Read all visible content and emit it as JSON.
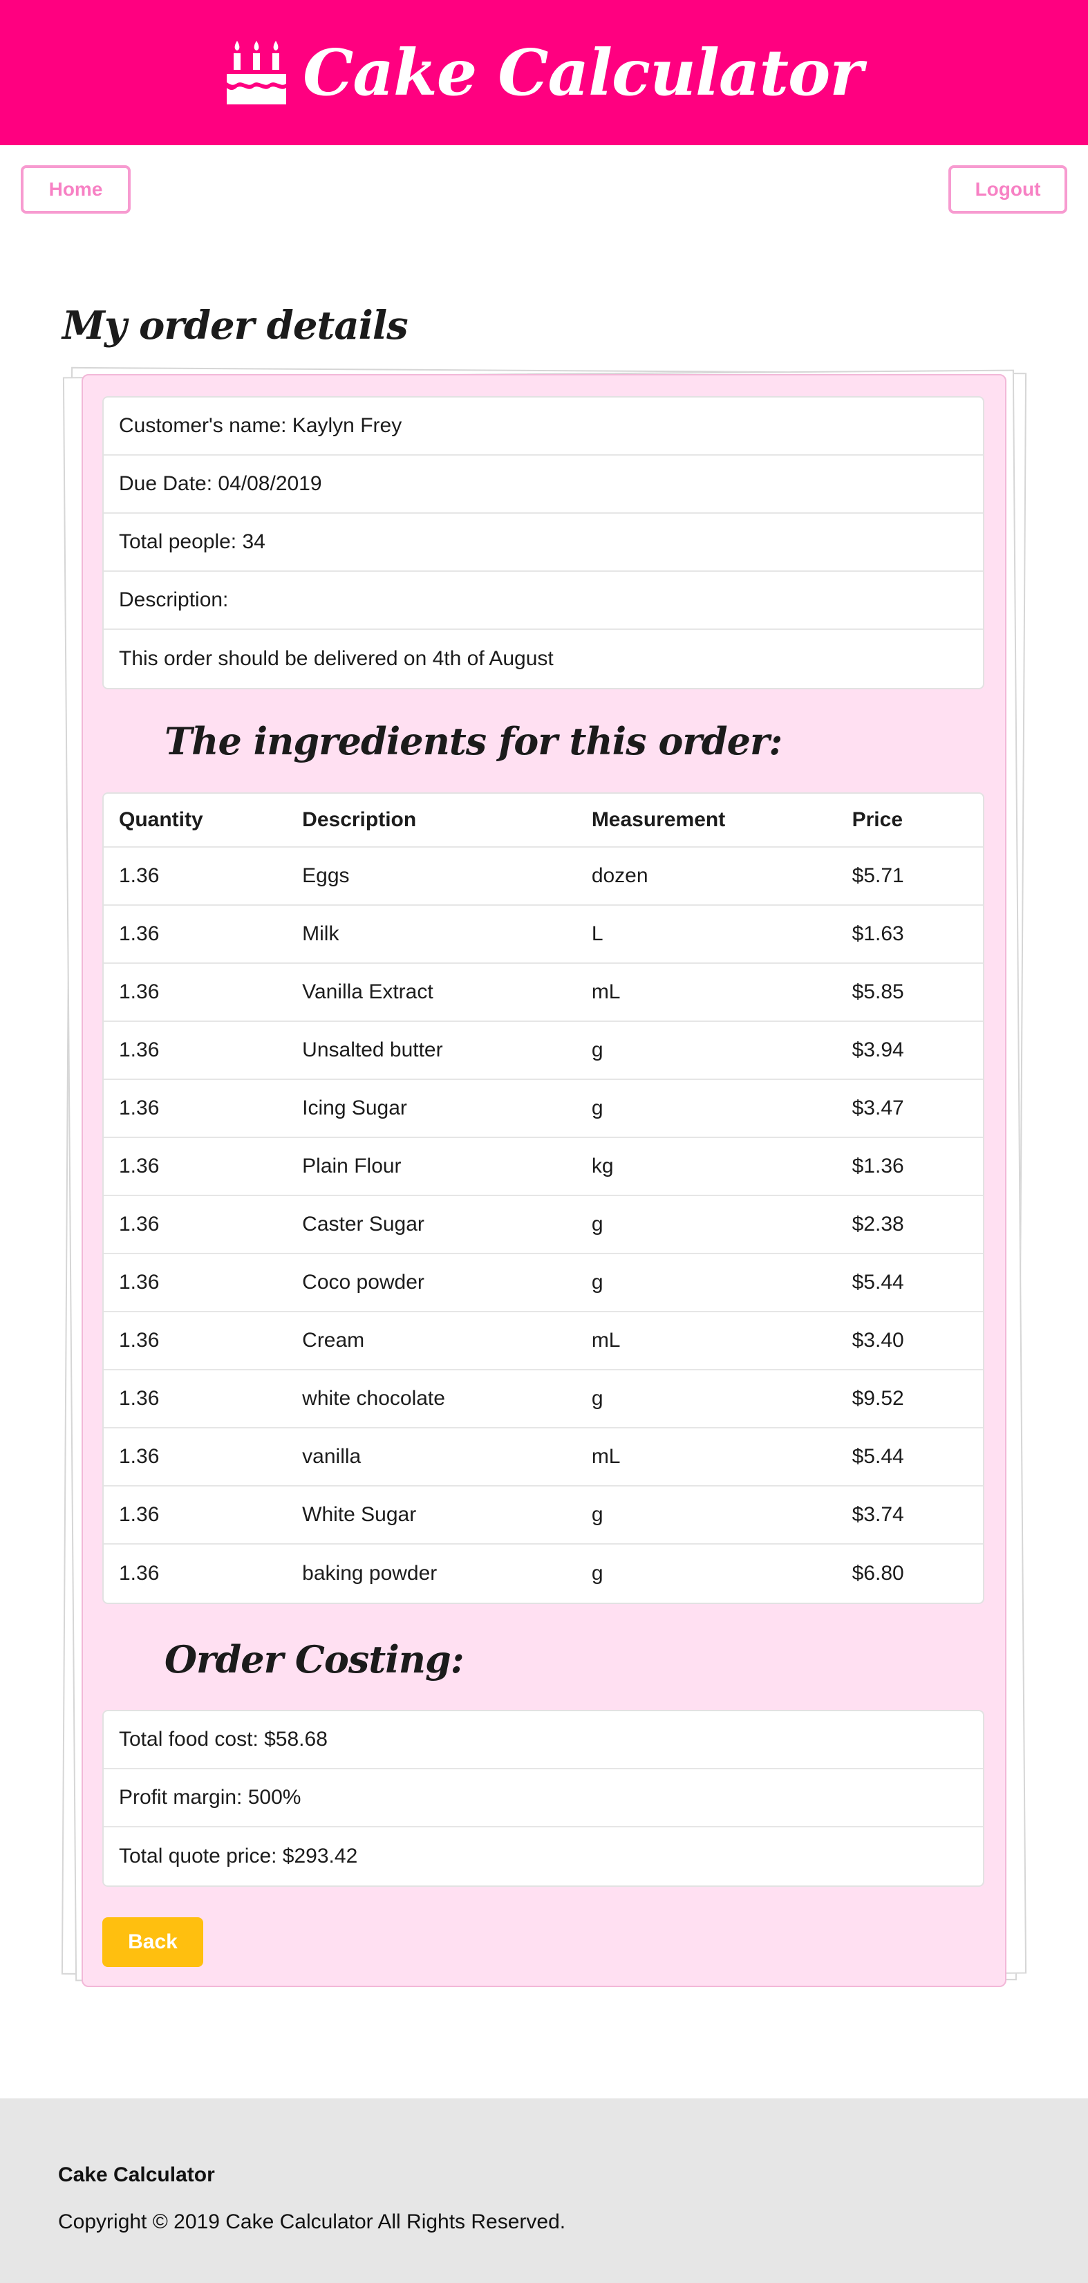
{
  "header": {
    "title": "Cake Calculator",
    "icon": "cake-icon",
    "color": "#ff0080"
  },
  "nav": {
    "home_label": "Home",
    "logout_label": "Logout"
  },
  "page": {
    "title": "My order details"
  },
  "order": {
    "customer": "Customer's name: Kaylyn Frey",
    "due_date": "Due Date: 04/08/2019",
    "total_people": "Total people: 34",
    "description_label": "Description:",
    "description": "This order should be delivered on 4th of August"
  },
  "ingredients": {
    "heading": "The ingredients for this order:",
    "columns": [
      "Quantity",
      "Description",
      "Measurement",
      "Price"
    ],
    "rows": [
      [
        "1.36",
        "Eggs",
        "dozen",
        "$5.71"
      ],
      [
        "1.36",
        "Milk",
        "L",
        "$1.63"
      ],
      [
        "1.36",
        "Vanilla Extract",
        "mL",
        "$5.85"
      ],
      [
        "1.36",
        "Unsalted butter",
        "g",
        "$3.94"
      ],
      [
        "1.36",
        "Icing Sugar",
        "g",
        "$3.47"
      ],
      [
        "1.36",
        "Plain Flour",
        "kg",
        "$1.36"
      ],
      [
        "1.36",
        "Caster Sugar",
        "g",
        "$2.38"
      ],
      [
        "1.36",
        "Coco powder",
        "g",
        "$5.44"
      ],
      [
        "1.36",
        "Cream",
        "mL",
        "$3.40"
      ],
      [
        "1.36",
        "white chocolate",
        "g",
        "$9.52"
      ],
      [
        "1.36",
        "vanilla",
        "mL",
        "$5.44"
      ],
      [
        "1.36",
        "White Sugar",
        "g",
        "$3.74"
      ],
      [
        "1.36",
        "baking powder",
        "g",
        "$6.80"
      ]
    ]
  },
  "costing": {
    "heading": "Order Costing:",
    "total_food_cost": "Total food cost: $58.68",
    "profit_margin": "Profit margin: 500%",
    "total_quote": "Total quote price: $293.42"
  },
  "actions": {
    "back_label": "Back",
    "back_color": "#ffbf0f"
  },
  "footer": {
    "brand": "Cake Calculator",
    "copyright": "Copyright © 2019 Cake Calculator All Rights Reserved."
  }
}
